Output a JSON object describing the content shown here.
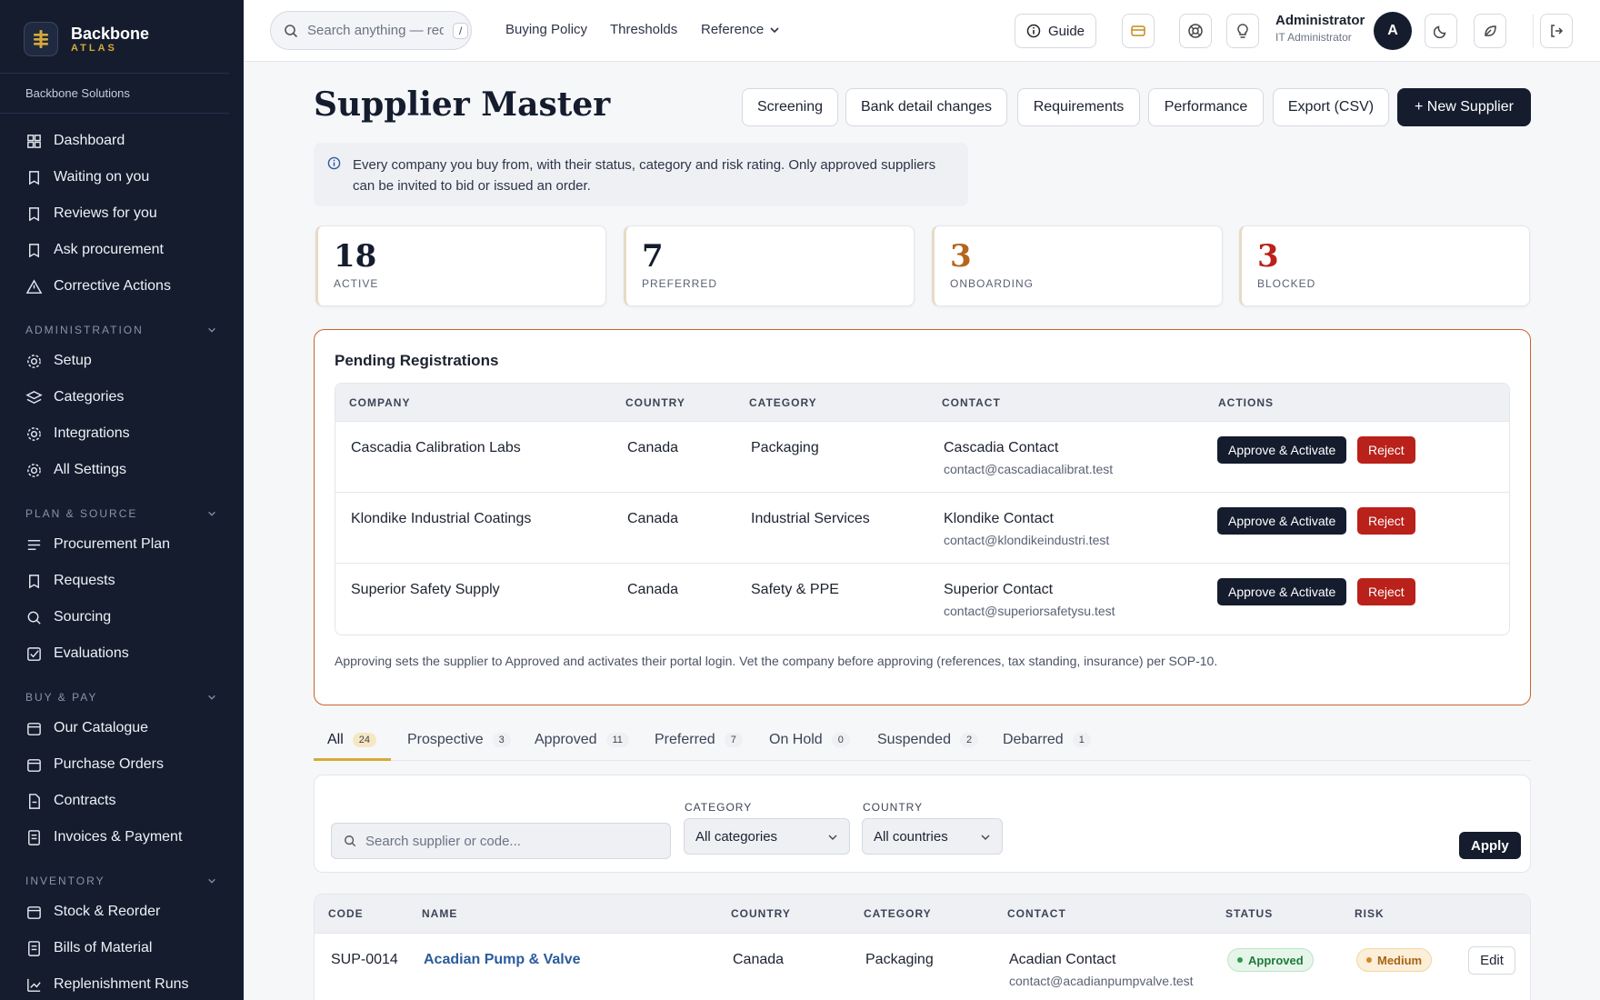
{
  "brand": {
    "name": "Backbone",
    "sub": "ATLAS",
    "org": "Backbone Solutions"
  },
  "sidebar": {
    "top_items": [
      {
        "label": "Dashboard",
        "icon": "grid-icon"
      },
      {
        "label": "Waiting on you",
        "icon": "bookmark-icon"
      },
      {
        "label": "Reviews for you",
        "icon": "bookmark-icon"
      },
      {
        "label": "Ask procurement",
        "icon": "bookmark-icon"
      },
      {
        "label": "Corrective Actions",
        "icon": "warning-icon"
      }
    ],
    "sections": [
      {
        "title": "ADMINISTRATION",
        "items": [
          {
            "label": "Setup",
            "icon": "gear-icon"
          },
          {
            "label": "Categories",
            "icon": "layers-icon"
          },
          {
            "label": "Integrations",
            "icon": "gear-icon"
          },
          {
            "label": "All Settings",
            "icon": "gear-icon"
          }
        ]
      },
      {
        "title": "PLAN & SOURCE",
        "items": [
          {
            "label": "Procurement Plan",
            "icon": "list-icon"
          },
          {
            "label": "Requests",
            "icon": "bookmark-icon"
          },
          {
            "label": "Sourcing",
            "icon": "search-icon"
          },
          {
            "label": "Evaluations",
            "icon": "checkbox-icon"
          }
        ]
      },
      {
        "title": "BUY & PAY",
        "items": [
          {
            "label": "Our Catalogue",
            "icon": "box-icon"
          },
          {
            "label": "Purchase Orders",
            "icon": "box-icon"
          },
          {
            "label": "Contracts",
            "icon": "document-icon"
          },
          {
            "label": "Invoices & Payment",
            "icon": "receipt-icon"
          }
        ]
      },
      {
        "title": "INVENTORY",
        "items": [
          {
            "label": "Stock & Reorder",
            "icon": "box-icon"
          },
          {
            "label": "Bills of Material",
            "icon": "receipt-icon"
          },
          {
            "label": "Replenishment Runs",
            "icon": "chart-icon"
          }
        ]
      }
    ]
  },
  "topbar": {
    "search_placeholder": "Search anything — req",
    "search_kbd": "/",
    "links": [
      "Buying Policy",
      "Thresholds",
      "Reference"
    ],
    "guide_label": "Guide",
    "user_name": "Administrator",
    "user_role": "IT Administrator",
    "avatar_initial": "A"
  },
  "page": {
    "title": "Supplier Master",
    "actions": [
      "Screening",
      "Bank detail changes",
      "Requirements",
      "Performance",
      "Export (CSV)",
      "+ New Supplier"
    ],
    "info": "Every company you buy from, with their status, category and risk rating. Only approved suppliers can be invited to bid or issued an order."
  },
  "kpis": [
    {
      "value": "18",
      "label": "ACTIVE",
      "color": "#141c2e"
    },
    {
      "value": "7",
      "label": "PREFERRED",
      "color": "#141c2e"
    },
    {
      "value": "3",
      "label": "ONBOARDING",
      "color": "#b5651d"
    },
    {
      "value": "3",
      "label": "BLOCKED",
      "color": "#b9211a"
    }
  ],
  "pending": {
    "title": "Pending Registrations",
    "headers": [
      "COMPANY",
      "COUNTRY",
      "CATEGORY",
      "CONTACT",
      "ACTIONS"
    ],
    "rows": [
      {
        "company": "Cascadia Calibration Labs",
        "country": "Canada",
        "category": "Packaging",
        "contact": "Cascadia Contact",
        "email": "contact@cascadiacalibrat.test"
      },
      {
        "company": "Klondike Industrial Coatings",
        "country": "Canada",
        "category": "Industrial Services",
        "contact": "Klondike Contact",
        "email": "contact@klondikeindustri.test"
      },
      {
        "company": "Superior Safety Supply",
        "country": "Canada",
        "category": "Safety & PPE",
        "contact": "Superior Contact",
        "email": "contact@superiorsafetysu.test"
      }
    ],
    "approve_label": "Approve & Activate",
    "reject_label": "Reject",
    "note": "Approving sets the supplier to Approved and activates their portal login. Vet the company before approving (references, tax standing, insurance) per SOP-10."
  },
  "tabs": [
    {
      "label": "All",
      "count": "24"
    },
    {
      "label": "Prospective",
      "count": "3"
    },
    {
      "label": "Approved",
      "count": "11"
    },
    {
      "label": "Preferred",
      "count": "7"
    },
    {
      "label": "On Hold",
      "count": "0"
    },
    {
      "label": "Suspended",
      "count": "2"
    },
    {
      "label": "Debarred",
      "count": "1"
    }
  ],
  "filters": {
    "search_placeholder": "Search supplier or code...",
    "category_label": "CATEGORY",
    "category_value": "All categories",
    "country_label": "COUNTRY",
    "country_value": "All countries",
    "apply_label": "Apply"
  },
  "suppliers": {
    "headers": [
      "CODE",
      "NAME",
      "COUNTRY",
      "CATEGORY",
      "CONTACT",
      "STATUS",
      "RISK"
    ],
    "rows": [
      {
        "code": "SUP-0014",
        "name": "Acadian Pump & Valve",
        "country": "Canada",
        "category": "Packaging",
        "contact": "Acadian Contact",
        "email": "contact@acadianpumpvalve.test",
        "status": "Approved",
        "risk": "Medium",
        "edit": "Edit"
      }
    ]
  }
}
